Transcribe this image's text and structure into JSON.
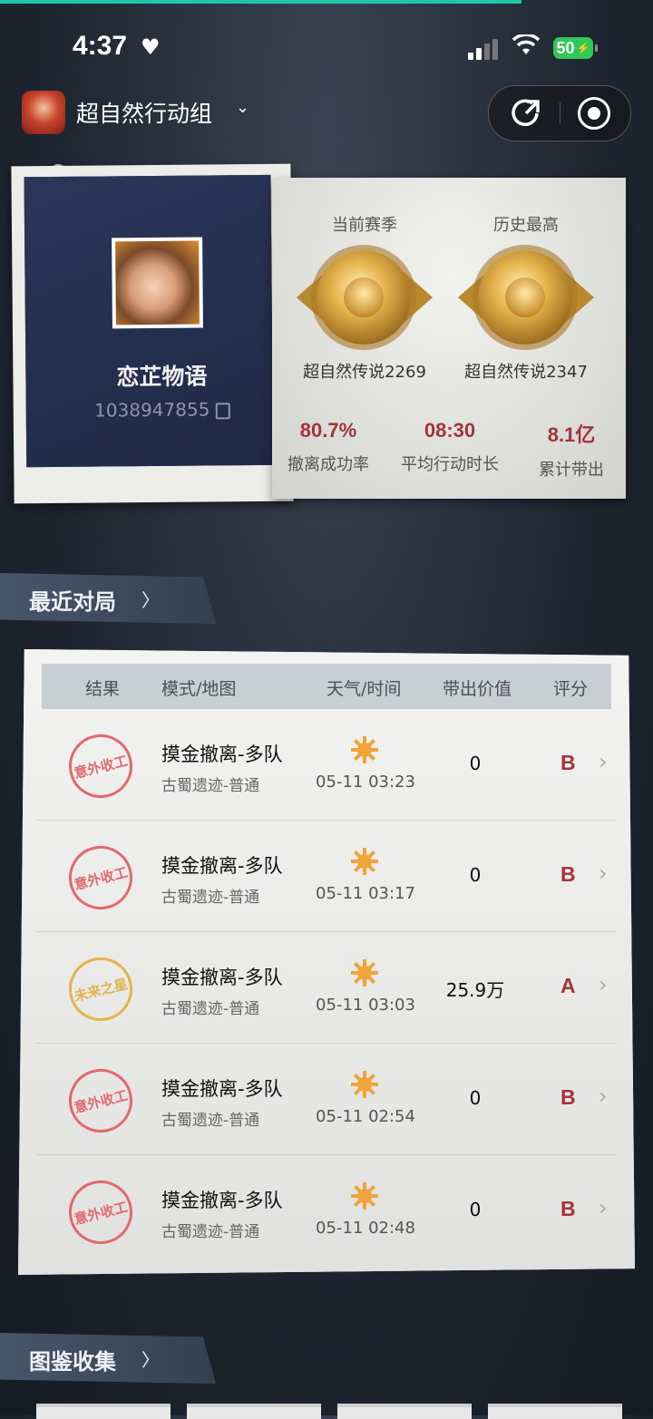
{
  "status_bar": {
    "time": "4:37",
    "battery": "50"
  },
  "header": {
    "title": "超自然行动组"
  },
  "profile": {
    "name": "恋芷物语",
    "id": "1038947855"
  },
  "ranks": {
    "current_label": "当前赛季",
    "current_rank": "超自然传说2269",
    "best_label": "历史最高",
    "best_rank": "超自然传说2347"
  },
  "stats": [
    {
      "value": "80.7%",
      "caption": "撤离成功率"
    },
    {
      "value": "08:30",
      "caption": "平均行动时长"
    },
    {
      "value": "8.1亿",
      "caption": "累计带出"
    }
  ],
  "recent": {
    "title": "最近对局",
    "columns": [
      "结果",
      "模式/地图",
      "天气/时间",
      "带出价值",
      "评分"
    ],
    "rows": [
      {
        "result": "意外收工",
        "mode": "摸金撤离-多队",
        "map": "古蜀遗迹-普通",
        "time": "05-11 03:23",
        "value": "0",
        "grade": "B"
      },
      {
        "result": "意外收工",
        "mode": "摸金撤离-多队",
        "map": "古蜀遗迹-普通",
        "time": "05-11 03:17",
        "value": "0",
        "grade": "B"
      },
      {
        "result": "未来之星",
        "mode": "摸金撤离-多队",
        "map": "古蜀遗迹-普通",
        "time": "05-11 03:03",
        "value": "25.9万",
        "grade": "A"
      },
      {
        "result": "意外收工",
        "mode": "摸金撤离-多队",
        "map": "古蜀遗迹-普通",
        "time": "05-11 02:54",
        "value": "0",
        "grade": "B"
      },
      {
        "result": "意外收工",
        "mode": "摸金撤离-多队",
        "map": "古蜀遗迹-普通",
        "time": "05-11 02:48",
        "value": "0",
        "grade": "B"
      }
    ]
  },
  "collection": {
    "title": "图鉴收集"
  },
  "icons": {
    "heart": "heart-icon",
    "signal": "signal-icon",
    "wifi": "wifi-icon",
    "chevron": "chevron-down-icon",
    "share": "share-icon",
    "record": "record-icon",
    "copy": "copy-icon",
    "sun": "sun-icon",
    "arrow": "chevron-right-icon"
  },
  "colors": {
    "accent": "#1fc6a8",
    "stat_red": "#a4343a",
    "stamp_red": "#e06a6e",
    "stamp_gold": "#e2b44c"
  }
}
